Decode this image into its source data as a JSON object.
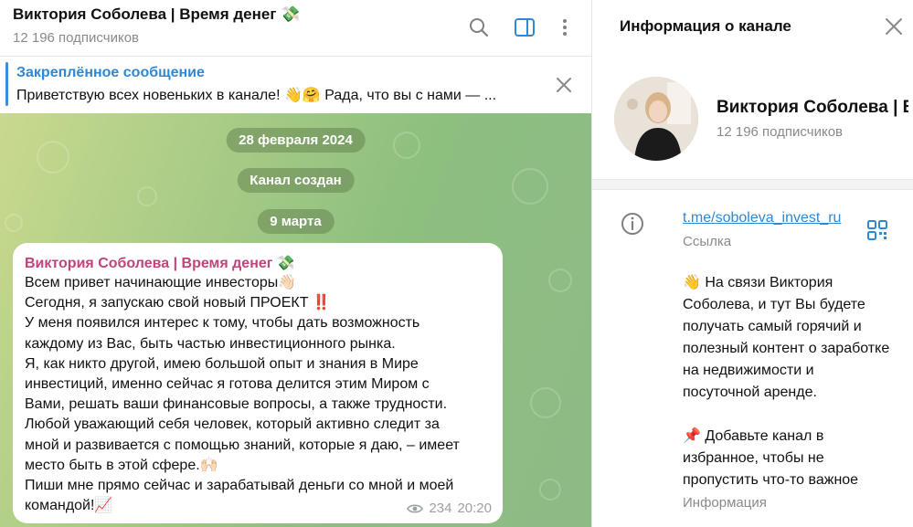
{
  "chat": {
    "title": "Виктория Соболева | Время денег 💸",
    "subscribers": "12 196 подписчиков",
    "pinned": {
      "title": "Закреплённое сообщение",
      "text": "Приветствую всех новеньких в канале! 👋🤗 Рада, что вы с нами — ..."
    },
    "service": {
      "date1": "28 февраля 2024",
      "created": "Канал создан",
      "date2": "9 марта"
    },
    "message": {
      "author": "Виктория Соболева | Время денег 💸",
      "lines": [
        "Всем привет начинающие инвесторы👋🏻",
        "Сегодня, я запускаю свой новый ПРОЕКТ ‼️",
        "У меня появился интерес к тому, чтобы дать возможность",
        "каждому из Вас, быть частью инвестиционного рынка.",
        "Я, как никто другой, имею большой опыт и знания в Мире",
        "инвестиций, именно сейчас я готова делится этим Миром с",
        "Вами, решать ваши финансовые вопросы, а также трудности.",
        "Любой уважающий себя человек, который активно следит за",
        "мной и развивается с помощью знаний, которые я даю, – имеет",
        "место быть в этой сфере.🙌🏻",
        "Пиши мне прямо сейчас и зарабатывай деньги со мной и моей",
        "командой!📈"
      ],
      "views": "234",
      "time": "20:20"
    }
  },
  "info": {
    "header": "Информация о канале",
    "name": "Виктория Соболева | Время денег 💸",
    "subscribers": "12 196 подписчиков",
    "link": "t.me/soboleva_invest_ru",
    "link_caption": "Ссылка",
    "description_lines": [
      "👋 На связи Виктория",
      "Соболева, и тут Вы будете",
      "получать самый горячий и",
      "полезный контент о заработке",
      "на недвижимости и",
      "посуточной аренде.",
      "",
      "📌 Добавьте канал в",
      "избранное, чтобы не",
      "пропустить что-то важное"
    ],
    "description_caption": "Информация"
  },
  "icons": {
    "search": "search-icon",
    "sidebar": "sidebar-toggle-icon",
    "more": "more-vertical-icon",
    "close": "close-icon",
    "info": "info-icon",
    "qr": "qr-code-icon",
    "eye": "eye-icon"
  },
  "colors": {
    "accent": "#2e88d4",
    "author": "#c0437c",
    "chat_bg_start": "#c9d98e",
    "chat_bg_end": "#8eba86"
  }
}
